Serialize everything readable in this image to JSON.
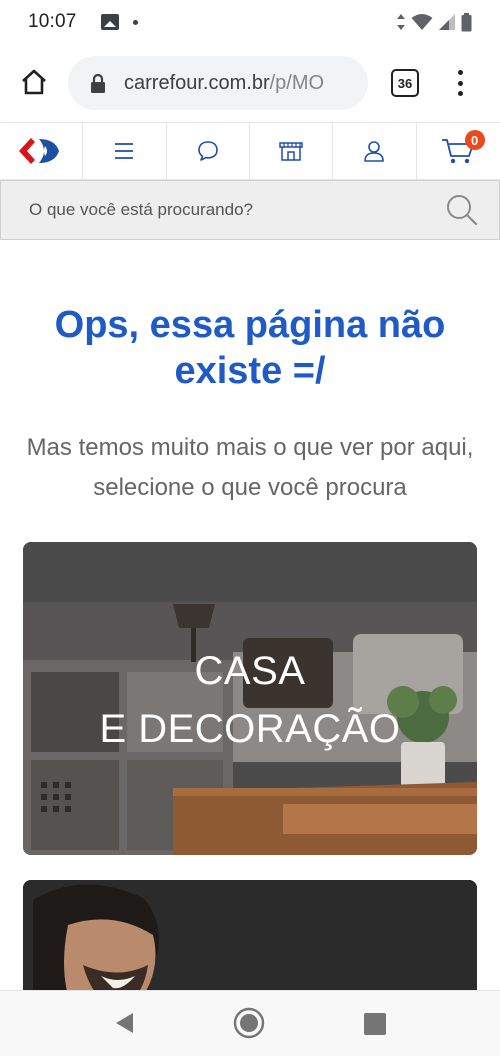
{
  "status_bar": {
    "time": "10:07"
  },
  "browser": {
    "url_domain": "carrefour.com.br",
    "url_path": "/p/MO",
    "tab_count": "36"
  },
  "site_nav": {
    "cart_count": "0"
  },
  "search": {
    "placeholder": "O que você está procurando?"
  },
  "content": {
    "headline": "Ops, essa página não existe =/",
    "subhead": "Mas temos muito mais o que ver por aqui, selecione o que você procura"
  },
  "categories": [
    {
      "title_line1": "CASA",
      "title_line2": "E DECORAÇÃO"
    }
  ],
  "colors": {
    "brand_blue": "#1e5bc6",
    "brand_red": "#e8491d",
    "icon_blue": "#1f4fa8"
  }
}
